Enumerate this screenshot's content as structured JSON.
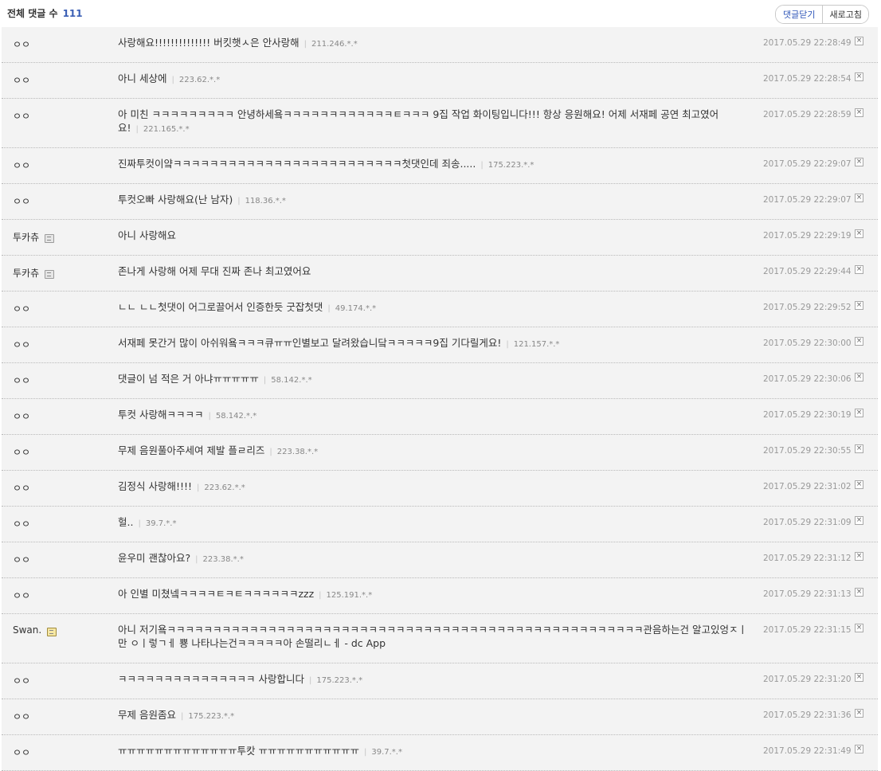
{
  "header": {
    "title": "전체 댓글 수",
    "count": "111",
    "close_comments": "댓글닫기",
    "refresh": "새로고침"
  },
  "comments": [
    {
      "nick": "ㅇㅇ",
      "text": "사랑해요!!!!!!!!!!!!!! 버킷햇ㅅ은 안사랑해",
      "ip": "211.246.*.*",
      "date": "2017.05.29 22:28:49"
    },
    {
      "nick": "ㅇㅇ",
      "text": "아니 세상에",
      "ip": "223.62.*.*",
      "date": "2017.05.29 22:28:54"
    },
    {
      "nick": "ㅇㅇ",
      "text": "아 미친 ㅋㅋㅋㅋㅋㅋㅋㅋㅋ 안녕하세욬ㅋㅋㅋㅋㅋㅋㅋㅋㅋㅋㅋㅋㅌㅋㅋㅋ 9집 작업 화이팅입니다!!! 항상 응원해요! 어제 서재페 공연 최고였어요!",
      "ip": "221.165.*.*",
      "date": "2017.05.29 22:28:59",
      "tall": true
    },
    {
      "nick": "ㅇㅇ",
      "text": "진짜투컷이얔ㅋㅋㅋㅋㅋㅋㅋㅋㅋㅋㅋㅋㅋㅋㅋㅋㅋㅋㅋㅋㅋㅋㅋㅋㅋ첫댓인데 죄송.....",
      "ip": "175.223.*.*",
      "date": "2017.05.29 22:29:07"
    },
    {
      "nick": "ㅇㅇ",
      "text": "투컷오빠 사랑해요(난 남자)",
      "ip": "118.36.*.*",
      "date": "2017.05.29 22:29:07"
    },
    {
      "nick": "투카츄",
      "badge": "member",
      "text": "아니 사랑해요",
      "ip": "",
      "date": "2017.05.29 22:29:19"
    },
    {
      "nick": "투카츄",
      "badge": "member",
      "text": "존나게 사랑해 어제 무대 진짜 존나 최고였어요",
      "ip": "",
      "date": "2017.05.29 22:29:44"
    },
    {
      "nick": "ㅇㅇ",
      "text": "ㄴㄴ ㄴㄴ첫댓이 어그로끌어서 인증한듯 굿잡첫댓",
      "ip": "49.174.*.*",
      "date": "2017.05.29 22:29:52"
    },
    {
      "nick": "ㅇㅇ",
      "text": "서재페 못간거 많이 아쉬워욬ㅋㅋㅋ큐ㅠㅠ인별보고 달려왔습니닼ㅋㅋㅋㅋㅋ9집 기다릴게요!",
      "ip": "121.157.*.*",
      "date": "2017.05.29 22:30:00"
    },
    {
      "nick": "ㅇㅇ",
      "text": "댓글이 넘 적은 거 아냐ㅠㅠㅠㅠㅠ",
      "ip": "58.142.*.*",
      "date": "2017.05.29 22:30:06"
    },
    {
      "nick": "ㅇㅇ",
      "text": "투컷 사랑해ㅋㅋㅋㅋ",
      "ip": "58.142.*.*",
      "date": "2017.05.29 22:30:19"
    },
    {
      "nick": "ㅇㅇ",
      "text": "무제 음원풀아주세여 제발 플ㄹ리즈",
      "ip": "223.38.*.*",
      "date": "2017.05.29 22:30:55"
    },
    {
      "nick": "ㅇㅇ",
      "text": "김정식 사랑해!!!!",
      "ip": "223.62.*.*",
      "date": "2017.05.29 22:31:02"
    },
    {
      "nick": "ㅇㅇ",
      "text": "헐..",
      "ip": "39.7.*.*",
      "date": "2017.05.29 22:31:09"
    },
    {
      "nick": "ㅇㅇ",
      "text": "윤우미 괜찮아요?",
      "ip": "223.38.*.*",
      "date": "2017.05.29 22:31:12"
    },
    {
      "nick": "ㅇㅇ",
      "text": "아 인별 미쳤넼ㅋㅋㅋㅋㅌㅋㅌㅋㅋㅋㅋㅋㅋzzz",
      "ip": "125.191.*.*",
      "date": "2017.05.29 22:31:13"
    },
    {
      "nick": "Swan.",
      "badge": "gold",
      "text": "아니 저기욬ㅋㅋㅋㅋㅋㅋㅋㅋㅋㅋㅋㅋㅋㅋㅋㅋㅋㅋㅋㅋㅋㅋㅋㅋㅋㅋㅋㅋㅋㅋㅋㅋㅋㅋㅋㅋㅋㅋㅋㅋㅋㅋㅋㅋㅋㅋㅋㅋㅋㅋㅋㅋ관음하는건 알고있엉ㅈㅣ만 ㅇㅣ렇ㄱㅔ 뿅 나타나는건ㅋㅋㅋㅋㅋ아 손떨리ㄴㅔ - dc App",
      "ip": "",
      "date": "2017.05.29 22:31:15",
      "tall": true
    },
    {
      "nick": "ㅇㅇ",
      "text": "ㅋㅋㅋㅋㅋㅋㅋㅋㅋㅋㅋㅋㅋㅋㅋ 사랑합니다",
      "ip": "175.223.*.*",
      "date": "2017.05.29 22:31:20"
    },
    {
      "nick": "ㅇㅇ",
      "text": "무제 음원좀요",
      "ip": "175.223.*.*",
      "date": "2017.05.29 22:31:36"
    },
    {
      "nick": "ㅇㅇ",
      "text": "ㅠㅠㅠㅠㅠㅠㅠㅠㅠㅠㅠㅠㅠ투캇 ㅠㅠㅠㅠㅠㅠㅠㅠㅠㅠㅠ",
      "ip": "39.7.*.*",
      "date": "2017.05.29 22:31:49"
    }
  ],
  "delete_glyph": "×",
  "icons": {
    "delete": "close-icon",
    "member": "member-icon",
    "gold": "gold-member-icon"
  }
}
